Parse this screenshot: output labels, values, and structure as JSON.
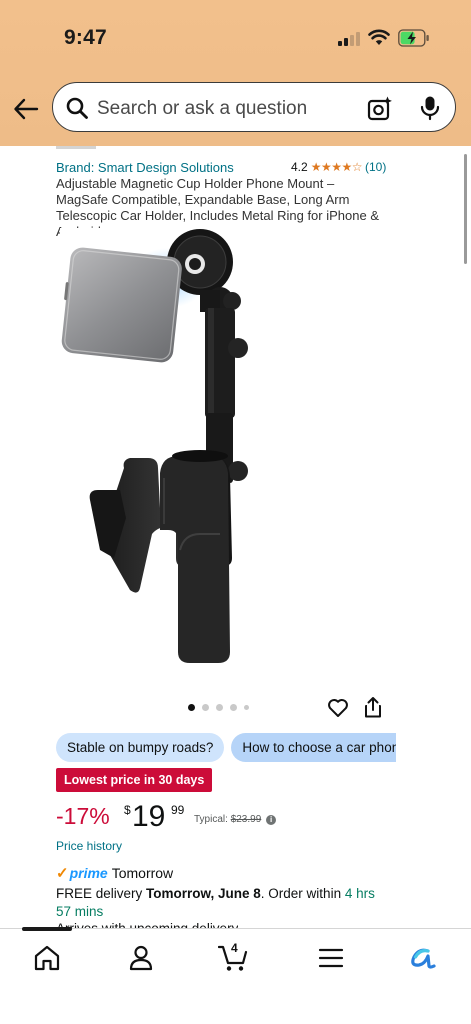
{
  "status_bar": {
    "time": "9:47"
  },
  "search": {
    "placeholder": "Search or ask a question"
  },
  "product": {
    "brand": "Brand: Smart Design Solutions",
    "rating": "4.2",
    "stars": "★★★★☆",
    "rating_count": "(10)",
    "title": "Adjustable Magnetic Cup Holder Phone Mount – MagSafe Compatible, Expandable Base, Long Arm Telescopic Car Holder, Includes Metal Ring for iPhone & Android",
    "image_count": 5,
    "active_image": 1
  },
  "chips": [
    "Stable on bumpy roads?",
    "How to choose a car phone mount"
  ],
  "deal_badge": "Lowest price in 30 days",
  "price": {
    "discount": "-17%",
    "symbol": "$",
    "whole": "19",
    "fraction": "99",
    "typical_label": "Typical: ",
    "typical_value": "$23.99"
  },
  "price_history_link": "Price history",
  "delivery": {
    "prime_word": "prime",
    "prime_day": "Tomorrow",
    "free_delivery": "FREE delivery ",
    "delivery_date": "Tomorrow, June 8",
    "order_within": ". Order within ",
    "countdown": "4 hrs 57 mins",
    "arrives": "Arrives with upcoming delivery"
  },
  "bottom_nav": {
    "items": [
      "home-icon",
      "account-icon",
      "cart-icon",
      "menu-icon",
      "rufus-icon"
    ],
    "cart_count": "4"
  },
  "colors": {
    "header": "#f2c08c",
    "link": "#007185",
    "deal": "#cc0c39",
    "star": "#de7921",
    "chip": "#cfe4fc",
    "prime": "#1a98ff",
    "countdown": "#067d62"
  }
}
